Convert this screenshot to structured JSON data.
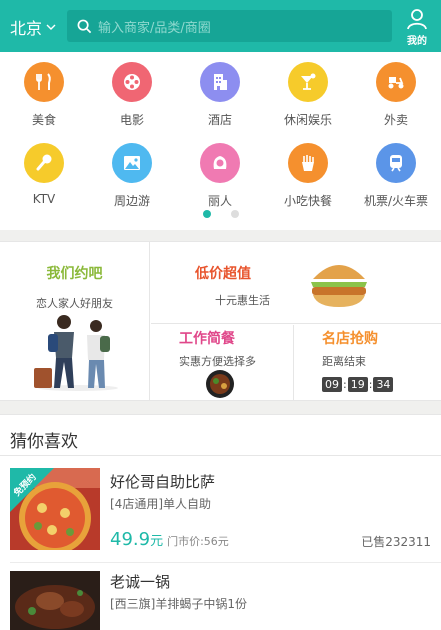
{
  "header": {
    "city": "北京",
    "search_placeholder": "输入商家/品类/商圈",
    "mine_label": "我的"
  },
  "categories": [
    {
      "label": "美食",
      "icon": "fork-knife-icon",
      "color": "#f5902e"
    },
    {
      "label": "电影",
      "icon": "film-reel-icon",
      "color": "#f06673"
    },
    {
      "label": "酒店",
      "icon": "building-icon",
      "color": "#8d8ef0"
    },
    {
      "label": "休闲娱乐",
      "icon": "cocktail-icon",
      "color": "#f6cb2b"
    },
    {
      "label": "外卖",
      "icon": "scooter-icon",
      "color": "#f5902e"
    },
    {
      "label": "KTV",
      "icon": "microphone-icon",
      "color": "#f6cb2b"
    },
    {
      "label": "周边游",
      "icon": "mountain-icon",
      "color": "#4fb9f0"
    },
    {
      "label": "丽人",
      "icon": "woman-icon",
      "color": "#f07ab2"
    },
    {
      "label": "小吃快餐",
      "icon": "fries-icon",
      "color": "#f5902e"
    },
    {
      "label": "机票/火车票",
      "icon": "train-icon",
      "color": "#5b95e8"
    }
  ],
  "pager": {
    "pages": 2,
    "active": 0
  },
  "promo": {
    "left": {
      "title": "我们约吧",
      "subtitle": "恋人家人好朋友",
      "color": "#8bb93a"
    },
    "top_right": {
      "title": "低价超值",
      "subtitle": "十元惠生活",
      "color": "#e8552e"
    },
    "bottom_left": {
      "title": "工作简餐",
      "subtitle": "实惠方便选择多",
      "color": "#e0478a"
    },
    "bottom_right": {
      "title": "名店抢购",
      "subtitle": "距离结束",
      "color": "#f5902e",
      "countdown": {
        "h": "09",
        "m": "19",
        "s": "34"
      }
    }
  },
  "guess": {
    "title": "猜你喜欢",
    "items": [
      {
        "name": "好伦哥自助比萨",
        "desc": "[4店通用]单人自助",
        "price": "49.9",
        "unit": "元",
        "orig": "门市价:56元",
        "sold": "已售232311",
        "badge": "免预约"
      },
      {
        "name": "老诚一锅",
        "desc": "[西三旗]羊排蝎子中锅1份"
      }
    ]
  }
}
